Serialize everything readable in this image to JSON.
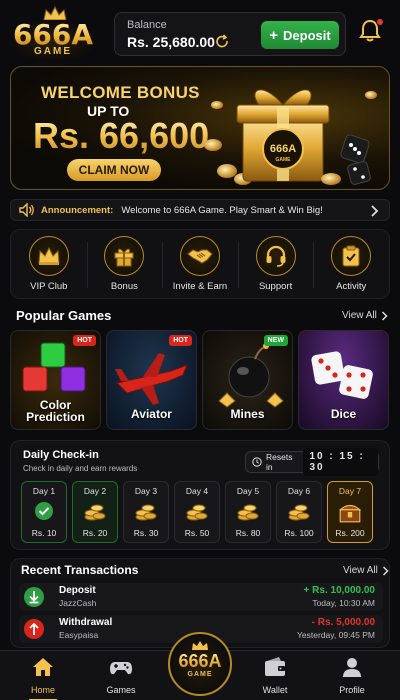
{
  "brand": {
    "logo_text": "666A",
    "logo_sub": "GAME"
  },
  "header": {
    "balance_label": "Balance",
    "balance_value": "Rs. 25,680.00",
    "deposit_label": "Deposit",
    "has_notification": true
  },
  "banner": {
    "title": "WELCOME BONUS",
    "subtitle": "UP TO",
    "amount": "Rs. 66,600",
    "cta": "CLAIM NOW",
    "badge_text": "666A",
    "badge_sub": "GAME"
  },
  "announcement": {
    "label": "Announcement:",
    "text": "Welcome to 666A Game. Play Smart & Win Big!"
  },
  "quick_menu": [
    {
      "label": "VIP Club",
      "icon": "crown-icon"
    },
    {
      "label": "Bonus",
      "icon": "gift-icon"
    },
    {
      "label": "Invite & Earn",
      "icon": "handshake-icon"
    },
    {
      "label": "Support",
      "icon": "headset-icon"
    },
    {
      "label": "Activity",
      "icon": "clipboard-check-icon"
    }
  ],
  "popular_games": {
    "title": "Popular Games",
    "view_all": "View All",
    "games": [
      {
        "label": "Color\nPrediction",
        "tag": "HOT"
      },
      {
        "label": "Aviator",
        "tag": "HOT"
      },
      {
        "label": "Mines",
        "tag": "NEW"
      },
      {
        "label": "Dice",
        "tag": ""
      }
    ]
  },
  "checkin": {
    "title": "Daily Check-in",
    "subtitle": "Check in daily and earn rewards",
    "resets_label": "Resets in",
    "timer": "10 : 15 : 30",
    "days": [
      {
        "label": "Day 1",
        "reward": "Rs. 10",
        "state": "done"
      },
      {
        "label": "Day 2",
        "reward": "Rs. 20",
        "state": "today"
      },
      {
        "label": "Day 3",
        "reward": "Rs. 30",
        "state": "upcoming"
      },
      {
        "label": "Day 4",
        "reward": "Rs. 50",
        "state": "upcoming"
      },
      {
        "label": "Day 5",
        "reward": "Rs. 80",
        "state": "upcoming"
      },
      {
        "label": "Day 6",
        "reward": "Rs. 100",
        "state": "upcoming"
      },
      {
        "label": "Day 7",
        "reward": "Rs. 200",
        "state": "final"
      }
    ]
  },
  "transactions": {
    "title": "Recent Transactions",
    "view_all": "View All",
    "items": [
      {
        "type": "Deposit",
        "method": "JazzCash",
        "amount": "+ Rs. 10,000.00",
        "time": "Today, 10:30 AM",
        "color": "#35c052"
      },
      {
        "type": "Withdrawal",
        "method": "Easypaisa",
        "amount": "- Rs. 5,000.00",
        "time": "Yesterday, 09:45 PM",
        "color": "#e0352b"
      }
    ]
  },
  "bottom_nav": {
    "items": [
      {
        "label": "Home",
        "icon": "home-icon",
        "active": true
      },
      {
        "label": "Games",
        "icon": "gamepad-icon",
        "active": false
      },
      {
        "label": "Wallet",
        "icon": "wallet-icon",
        "active": false
      },
      {
        "label": "Profile",
        "icon": "user-icon",
        "active": false
      }
    ],
    "center_text": "666A",
    "center_sub": "GAME"
  },
  "colors": {
    "accent_gold": "#f2c14e",
    "success": "#35c052",
    "danger": "#e0352b",
    "background": "#0b0b0d"
  }
}
